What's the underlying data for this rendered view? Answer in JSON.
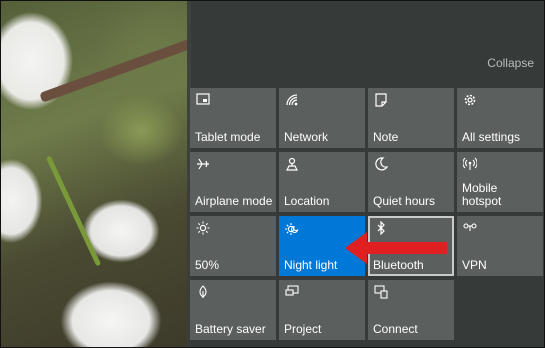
{
  "panel": {
    "collapse_label": "Collapse"
  },
  "tiles": [
    {
      "label": "Tablet mode",
      "icon": "tablet-mode-icon"
    },
    {
      "label": "Network",
      "icon": "network-icon"
    },
    {
      "label": "Note",
      "icon": "note-icon"
    },
    {
      "label": "All settings",
      "icon": "gear-icon"
    },
    {
      "label": "Airplane mode",
      "icon": "airplane-icon"
    },
    {
      "label": "Location",
      "icon": "location-icon"
    },
    {
      "label": "Quiet hours",
      "icon": "moon-icon"
    },
    {
      "label": "Mobile\nhotspot",
      "icon": "hotspot-icon"
    },
    {
      "label": "50%",
      "icon": "brightness-icon"
    },
    {
      "label": "Night light",
      "icon": "night-light-icon",
      "state": "on"
    },
    {
      "label": "Bluetooth",
      "icon": "bluetooth-icon"
    },
    {
      "label": "VPN",
      "icon": "vpn-icon"
    },
    {
      "label": "Battery saver",
      "icon": "battery-saver-icon"
    },
    {
      "label": "Project",
      "icon": "project-icon"
    },
    {
      "label": "Connect",
      "icon": "connect-icon"
    }
  ],
  "colors": {
    "accent": "#0078d7",
    "arrow": "#e02020",
    "panel": "#3a3e3c",
    "tile": "#5f6462"
  }
}
